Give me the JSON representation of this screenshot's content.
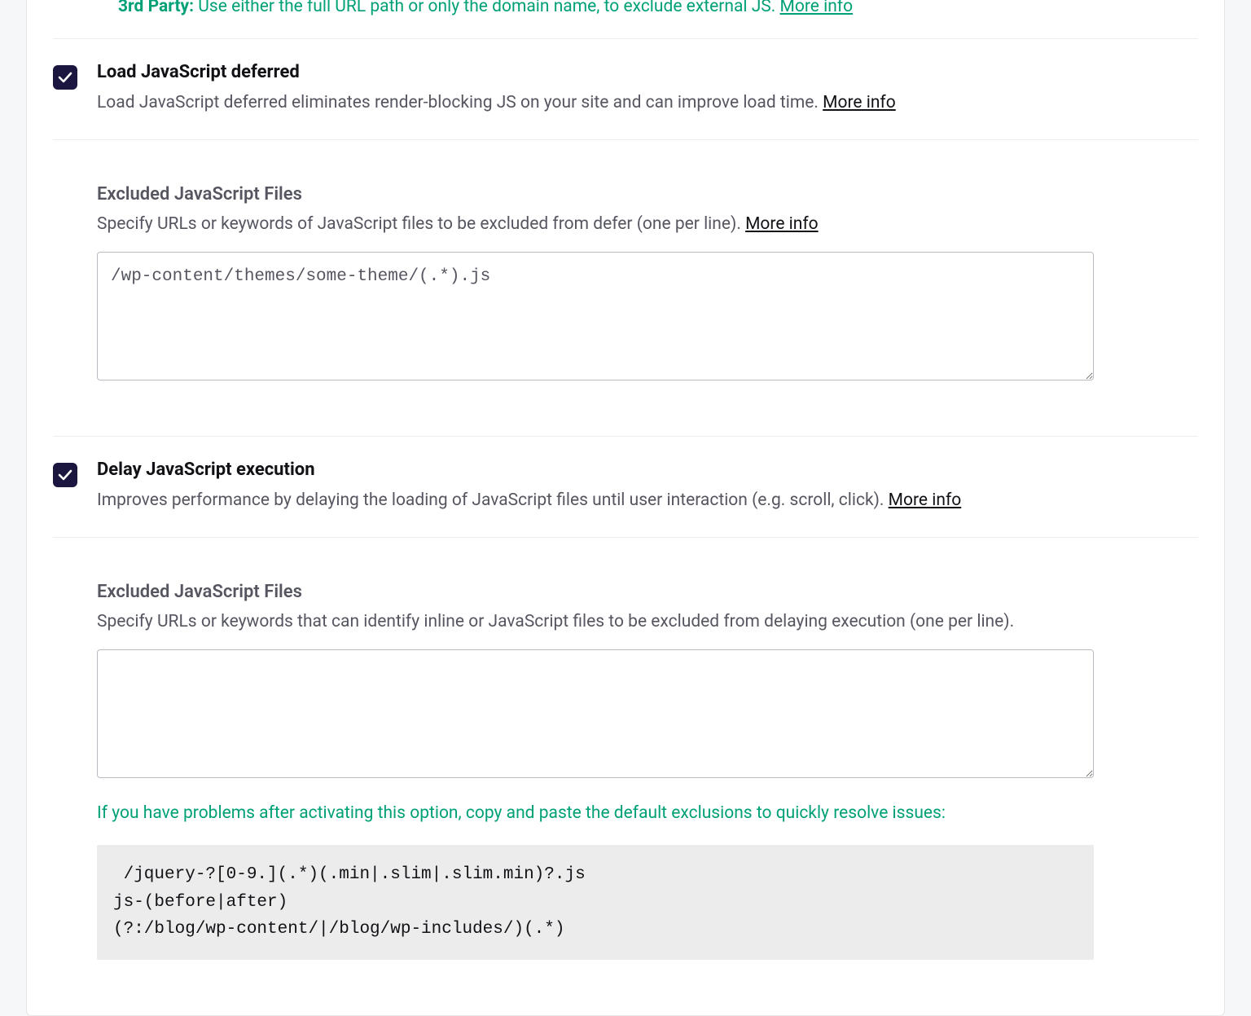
{
  "top_partial": {
    "label": "3rd Party:",
    "desc": "Use either the full URL path or only the domain name, to exclude external JS.",
    "more_info": "More info"
  },
  "defer": {
    "title": "Load JavaScript deferred",
    "desc": "Load JavaScript deferred eliminates render-blocking JS on your site and can improve load time. ",
    "more_info": "More info",
    "checked": true,
    "excluded": {
      "title": "Excluded JavaScript Files",
      "desc": "Specify URLs or keywords of JavaScript files to be excluded from defer (one per line). ",
      "more_info": "More info",
      "value": "/wp-content/themes/some-theme/(.*).js"
    }
  },
  "delay": {
    "title": "Delay JavaScript execution",
    "desc": "Improves performance by delaying the loading of JavaScript files until user interaction (e.g. scroll, click). ",
    "more_info": "More info",
    "checked": true,
    "excluded": {
      "title": "Excluded JavaScript Files",
      "desc": "Specify URLs or keywords that can identify inline or JavaScript files to be excluded from delaying execution (one per line).",
      "value": ""
    },
    "hint": "If you have problems after activating this option, copy and paste the default exclusions to quickly resolve issues:",
    "defaults": " /jquery-?[0-9.](.*)(.min|.slim|.slim.min)?.js\njs-(before|after)\n(?:/blog/wp-content/|/blog/wp-includes/)(.*)"
  }
}
